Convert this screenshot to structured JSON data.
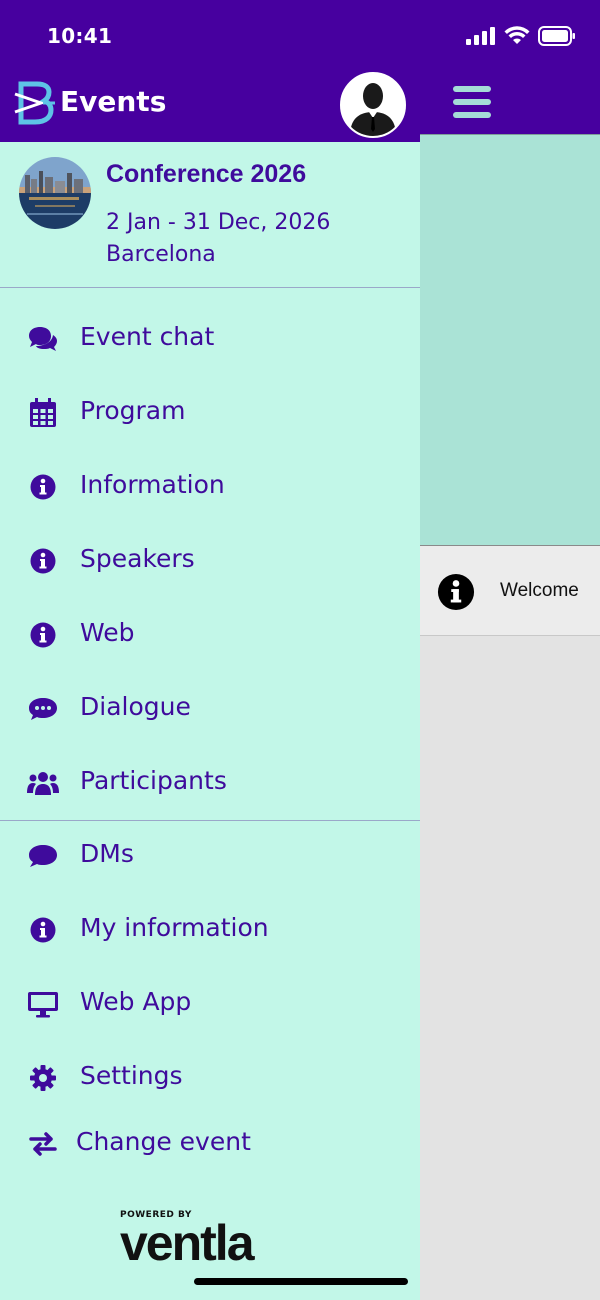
{
  "status_bar": {
    "time": "10:41"
  },
  "app": {
    "title": "Events"
  },
  "event": {
    "name": "Conference 2026",
    "dates": "2 Jan - 31 Dec, 2026",
    "city": "Barcelona"
  },
  "menu_primary": [
    {
      "label": "Event chat",
      "icon": "chat-bubbles-icon"
    },
    {
      "label": "Program",
      "icon": "calendar-icon"
    },
    {
      "label": "Information",
      "icon": "info-icon"
    },
    {
      "label": "Speakers",
      "icon": "info-icon"
    },
    {
      "label": "Web",
      "icon": "info-icon"
    },
    {
      "label": "Dialogue",
      "icon": "speech-bubble-icon"
    },
    {
      "label": "Participants",
      "icon": "users-icon"
    }
  ],
  "menu_secondary": [
    {
      "label": "DMs",
      "icon": "comment-icon"
    },
    {
      "label": "My information",
      "icon": "info-icon"
    },
    {
      "label": "Web App",
      "icon": "desktop-icon"
    },
    {
      "label": "Settings",
      "icon": "gear-icon"
    },
    {
      "label": "Change event",
      "icon": "swap-arrows-icon"
    }
  ],
  "powered": {
    "prefix": "POWERED BY",
    "brand": "ventla"
  },
  "main_content": {
    "item_label": "Welcome",
    "item_icon": "info-icon"
  },
  "colors": {
    "brand_purple": "#47009f",
    "drawer_bg": "#c2f7e8",
    "menu_text": "#3f0b9c",
    "banner_bg": "#aae3d6"
  }
}
